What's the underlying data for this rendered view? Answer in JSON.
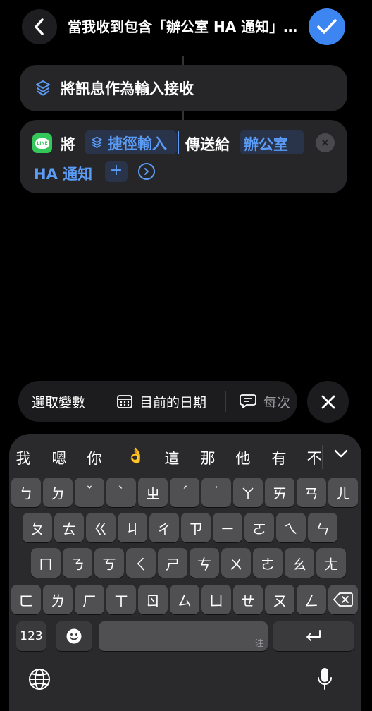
{
  "header": {
    "title": "當我收到包含「辦公室 HA 通知」的訊息時",
    "back_icon": "chevron-left-icon",
    "done_icon": "checkmark-icon",
    "accent_color": "#3d86f2"
  },
  "actions": [
    {
      "icon": "shortcuts-layers-icon",
      "label": "將訊息作為輸入接收"
    },
    {
      "app_icon": "line-app-icon",
      "app_icon_text": "LINE",
      "verb": "將",
      "input_token": "捷徑輸入",
      "send_to_text": "傳送給",
      "recipient": "辦公室",
      "recipient_cont": "HA 通知",
      "add_label": "+",
      "remove_icon": "remove-icon",
      "expand_icon": "chevron-right-circle-icon"
    }
  ],
  "variable_bar": {
    "select_variable": "選取變數",
    "current_date": "目前的日期",
    "each_time": "每次",
    "close_icon": "close-icon"
  },
  "keyboard": {
    "candidates": [
      "我",
      "嗯",
      "你",
      "👌",
      "這",
      "那",
      "他",
      "有",
      "不"
    ],
    "rows": [
      [
        "ㄅ",
        "ㄉ",
        "ˇ",
        "ˋ",
        "ㄓ",
        "ˊ",
        "˙",
        "ㄚ",
        "ㄞ",
        "ㄢ",
        "ㄦ"
      ],
      [
        "ㄆ",
        "ㄊ",
        "ㄍ",
        "ㄐ",
        "ㄔ",
        "ㄗ",
        "ㄧ",
        "ㄛ",
        "ㄟ",
        "ㄣ"
      ],
      [
        "ㄇ",
        "ㄋ",
        "ㄎ",
        "ㄑ",
        "ㄕ",
        "ㄘ",
        "ㄨ",
        "ㄜ",
        "ㄠ",
        "ㄤ"
      ],
      [
        "ㄈ",
        "ㄌ",
        "ㄏ",
        "ㄒ",
        "ㄖ",
        "ㄙ",
        "ㄩ",
        "ㄝ",
        "ㄡ",
        "ㄥ"
      ]
    ],
    "numbers_label": "123",
    "space_hint": "注",
    "emoji_icon": "emoji-icon",
    "delete_icon": "delete-icon",
    "return_icon": "return-icon",
    "globe_icon": "globe-icon",
    "mic_icon": "microphone-icon",
    "collapse_icon": "chevron-down-icon"
  }
}
